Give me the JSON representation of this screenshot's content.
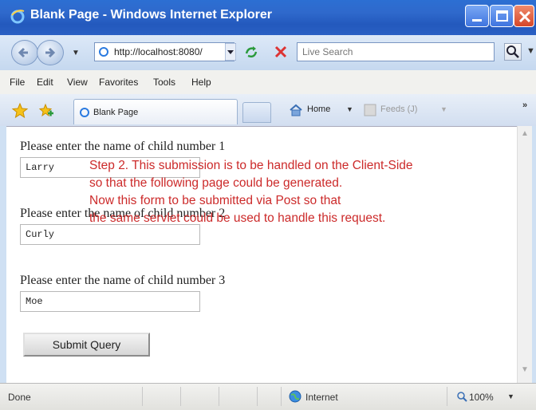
{
  "window": {
    "title": "Blank Page - Windows Internet Explorer"
  },
  "address_bar": {
    "url": "http://localhost:8080/",
    "search_placeholder": "Live Search"
  },
  "menu": {
    "items": [
      "File",
      "Edit",
      "View",
      "Favorites",
      "Tools",
      "Help"
    ]
  },
  "tabs": {
    "active_label": "Blank Page",
    "home_label": "Home",
    "feeds_label": "Feeds (J)"
  },
  "form": {
    "fields": [
      {
        "label": "Please enter the name of child number 1",
        "value": "Larry"
      },
      {
        "label": "Please enter the name of child number 2",
        "value": "Curly"
      },
      {
        "label": "Please enter the name of child number 3",
        "value": "Moe"
      }
    ],
    "submit_label": "Submit Query"
  },
  "annotation": {
    "lines": [
      "Step 2. This submission is to be handled on the Client-Side",
      "so that the following page could be generated.",
      "Now this form to be submitted via Post so that",
      "the same servlet could be used to handle this request."
    ],
    "color": "#cc2a2a"
  },
  "status_bar": {
    "status": "Done",
    "zone": "Internet",
    "zoom": "100%"
  },
  "colors": {
    "title_bar": "#2f69cc",
    "chrome": "#cfe0f3"
  }
}
